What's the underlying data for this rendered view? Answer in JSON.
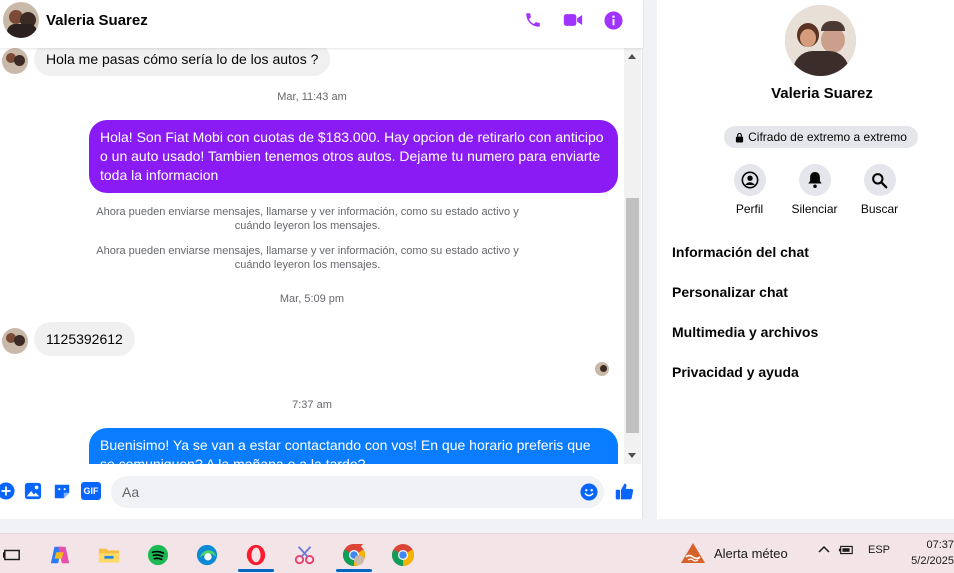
{
  "colors": {
    "accent_purple": "#8a1bf5",
    "outgoing_blue": "#0a7cff",
    "messenger_blue": "#0866ff"
  },
  "header": {
    "contact_name": "Valeria Suarez",
    "icons": [
      "phone-icon",
      "video-icon",
      "info-icon"
    ]
  },
  "messages": {
    "msg1": "Hola me pasas cómo sería lo de los autos ?",
    "ts1": "Mar, 11:43 am",
    "msg2": "Hola! Son Fiat Mobi con cuotas de $183.000. Hay opcion de retirarlo con anticipo o un auto usado! Tambien tenemos otros autos. Dejame tu numero para enviarte toda la informacion",
    "sys1": "Ahora pueden enviarse mensajes, llamarse y ver información, como su estado activo y cuándo leyeron los mensajes.",
    "sys2": "Ahora pueden enviarse mensajes, llamarse y ver información, como su estado activo y cuándo leyeron los mensajes.",
    "ts2": "Mar, 5:09 pm",
    "msg3": "1125392612",
    "ts3": "7:37 am",
    "msg4": "Buenisimo! Ya se van a estar contactando con vos! En que horario preferis que se comuniquen? A la mañana o a la tarde?"
  },
  "composer": {
    "placeholder": "Aa",
    "icons": [
      "plus-icon",
      "image-icon",
      "sticker-icon",
      "gif-icon",
      "emoji-icon",
      "thumbs-up-icon"
    ],
    "gif_label": "GIF"
  },
  "info_panel": {
    "name": "Valeria Suarez",
    "encryption": "Cifrado de extremo a extremo",
    "actions": [
      {
        "label": "Perfil",
        "icon": "profile-icon"
      },
      {
        "label": "Silenciar",
        "icon": "bell-icon"
      },
      {
        "label": "Buscar",
        "icon": "search-icon"
      }
    ],
    "menu": [
      "Información del chat",
      "Personalizar chat",
      "Multimedia y archivos",
      "Privacidad y ayuda"
    ]
  },
  "taskbar": {
    "apps": [
      "task-view-icon",
      "copilot-icon",
      "file-explorer-icon",
      "spotify-icon",
      "edge-icon",
      "opera-icon",
      "snipping-tool-icon",
      "chrome-profile-icon",
      "chrome-icon"
    ],
    "weather": "Alerta méteo",
    "language": "ESP",
    "time": "07:37",
    "date": "5/2/2025"
  }
}
